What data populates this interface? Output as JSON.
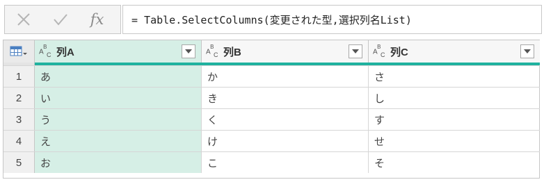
{
  "formula_bar": {
    "cancel_icon": "x-icon",
    "confirm_icon": "checkmark-icon",
    "fx_label": "fx",
    "formula": "= Table.SelectColumns(変更された型,選択列名List)"
  },
  "table": {
    "corner_icon": "table-menu-icon",
    "columns": [
      {
        "type_icon": "text-type-icon",
        "label": "列A",
        "selected": true
      },
      {
        "type_icon": "text-type-icon",
        "label": "列B",
        "selected": false
      },
      {
        "type_icon": "text-type-icon",
        "label": "列C",
        "selected": false
      }
    ],
    "rows": [
      {
        "num": "1",
        "cells": [
          "あ",
          "か",
          "さ"
        ]
      },
      {
        "num": "2",
        "cells": [
          "い",
          "き",
          "し"
        ]
      },
      {
        "num": "3",
        "cells": [
          "う",
          "く",
          "す"
        ]
      },
      {
        "num": "4",
        "cells": [
          "え",
          "け",
          "せ"
        ]
      },
      {
        "num": "5",
        "cells": [
          "お",
          "こ",
          "そ"
        ]
      }
    ],
    "accent_color": "#1fb29f",
    "selected_column_color": "#d6efe6"
  }
}
